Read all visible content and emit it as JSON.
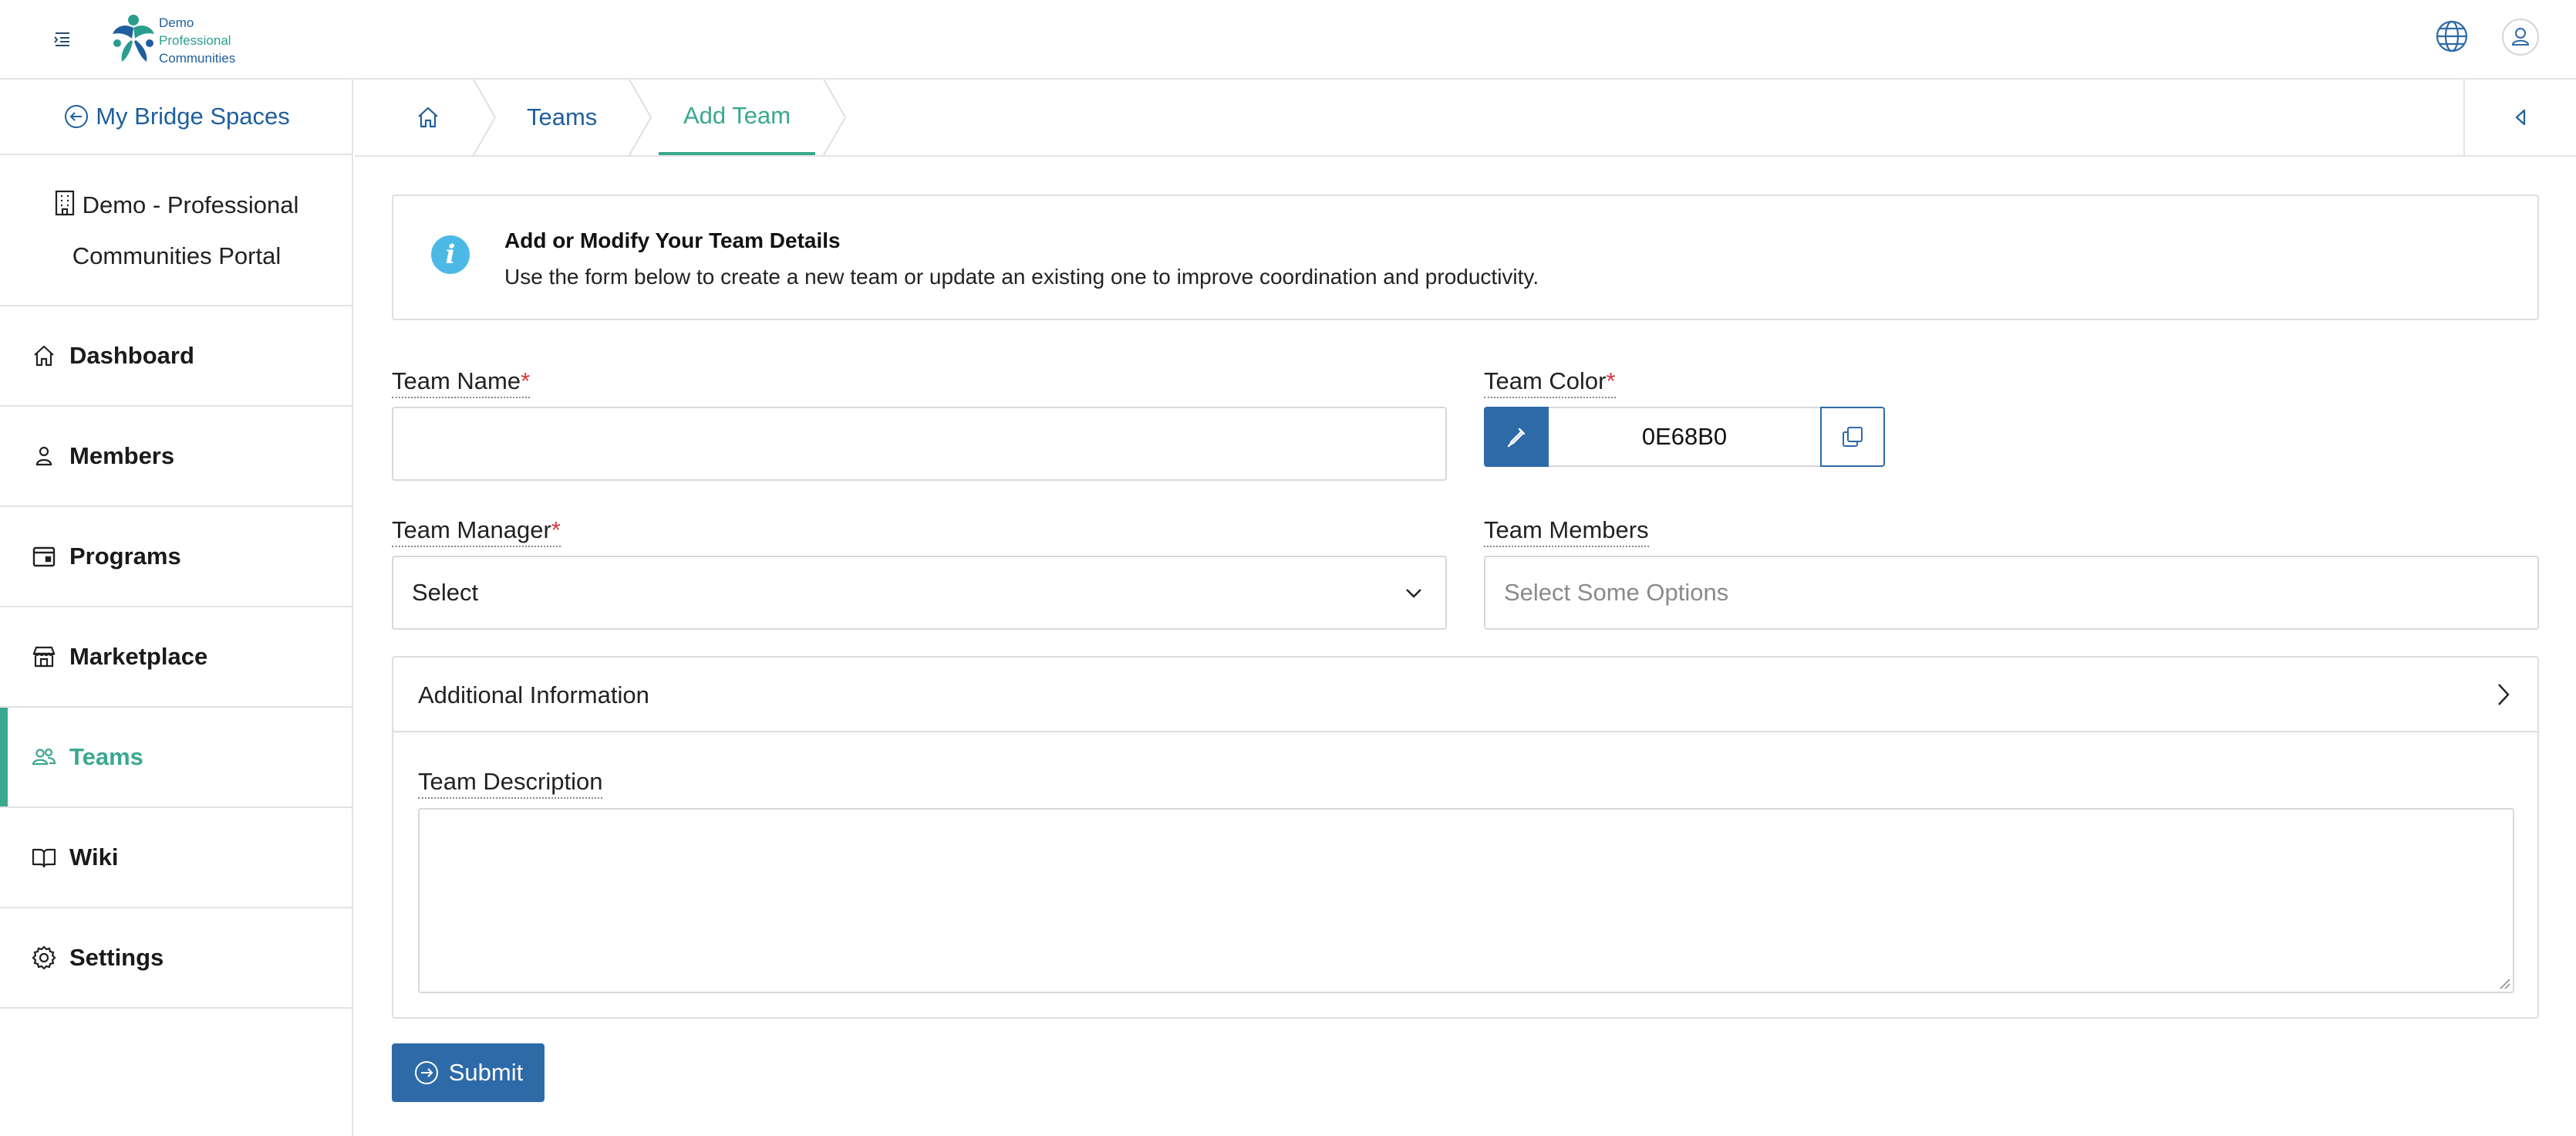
{
  "header": {
    "logo_lines": [
      "Demo",
      "Professional",
      "Communities"
    ]
  },
  "sidebar": {
    "back_label": "My Bridge Spaces",
    "org_line1": "Demo - Professional",
    "org_line2": "Communities Portal",
    "items": [
      {
        "label": "Dashboard",
        "icon": "home-icon"
      },
      {
        "label": "Members",
        "icon": "person-icon"
      },
      {
        "label": "Programs",
        "icon": "calendar-icon"
      },
      {
        "label": "Marketplace",
        "icon": "store-icon"
      },
      {
        "label": "Teams",
        "icon": "people-icon",
        "active": true
      },
      {
        "label": "Wiki",
        "icon": "book-icon"
      },
      {
        "label": "Settings",
        "icon": "gear-icon"
      }
    ]
  },
  "breadcrumb": {
    "teams": "Teams",
    "current": "Add Team"
  },
  "alert": {
    "title": "Add or Modify Your Team Details",
    "text": "Use the form below to create a new team or update an existing one to improve coordination and productivity."
  },
  "form": {
    "team_name_label": "Team Name",
    "team_name_value": "",
    "team_color_label": "Team Color",
    "team_color_value": "0E68B0",
    "team_manager_label": "Team Manager",
    "team_manager_value": "Select",
    "team_members_label": "Team Members",
    "team_members_placeholder": "Select Some Options",
    "additional_info_label": "Additional Information",
    "team_description_label": "Team Description",
    "required_mark": "*",
    "submit_label": "Submit"
  },
  "colors": {
    "primary": "#2e6aa8",
    "accent": "#3aa88e",
    "required": "#d9363e",
    "info": "#4cb8e6"
  }
}
